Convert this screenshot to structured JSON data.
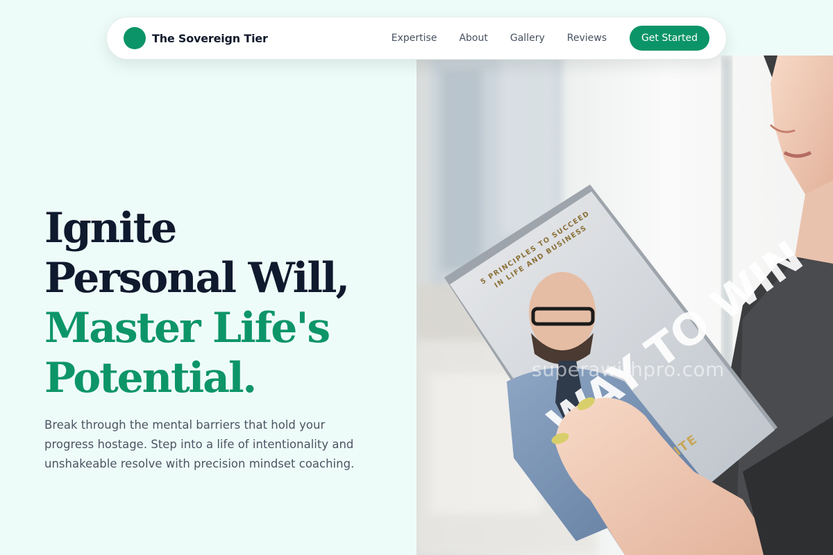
{
  "nav": {
    "brand": "The Sovereign Tier",
    "links": [
      "Expertise",
      "About",
      "Gallery",
      "Reviews"
    ],
    "cta": "Get Started"
  },
  "hero": {
    "title_line1": "Ignite",
    "title_line2": "Personal Will,",
    "title_line3": "Master Life's",
    "title_line4": "Potential.",
    "subtitle": "Break through the mental barriers that hold your progress hostage. Step into a life of intentionality and unshakeable resolve with precision mindset coaching."
  },
  "photo": {
    "book_tagline_1": "5 PRINCIPLES TO SUCCEED",
    "book_tagline_2": "IN LIFE AND BUSINESS",
    "book_title": "WAY TO WIN",
    "book_author": "WHITE",
    "watermark": "superawithpro.com"
  },
  "colors": {
    "brand_green": "#0b9467",
    "heading_dark": "#101a2e",
    "background_mint": "#eefcf9"
  },
  "icons": {
    "brand_logo": "green-circle"
  }
}
